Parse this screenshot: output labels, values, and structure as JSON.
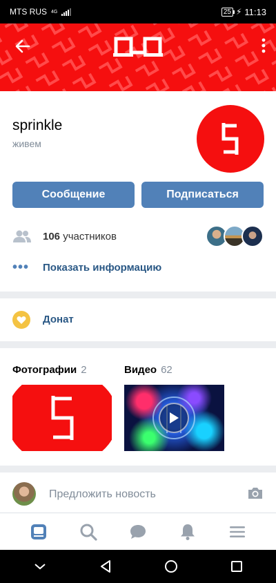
{
  "status_bar": {
    "carrier": "MTS RUS",
    "network": "4G",
    "battery": "25",
    "time": "11:13"
  },
  "cover": {
    "back_icon": "arrow-left-icon",
    "logo_icon": "group-logo-icon",
    "more_icon": "more-vertical-icon"
  },
  "group": {
    "name": "sprinkle",
    "status": "живем",
    "buttons": {
      "message": "Сообщение",
      "subscribe": "Подписаться"
    },
    "members": {
      "count": "106",
      "label": "участников"
    },
    "show_info": "Показать информацию"
  },
  "donat": {
    "label": "Донат"
  },
  "media": {
    "photos": {
      "title": "Фотографии",
      "count": "2"
    },
    "videos": {
      "title": "Видео",
      "count": "62"
    }
  },
  "suggest": {
    "placeholder": "Предложить новость"
  },
  "tabbar": {
    "items": [
      "news-icon",
      "search-icon",
      "messages-icon",
      "notifications-icon",
      "menu-icon"
    ]
  },
  "colors": {
    "brand_red": "#f50f0f",
    "vk_blue": "#5181b8",
    "link_blue": "#2a5885",
    "muted": "#818c99"
  }
}
